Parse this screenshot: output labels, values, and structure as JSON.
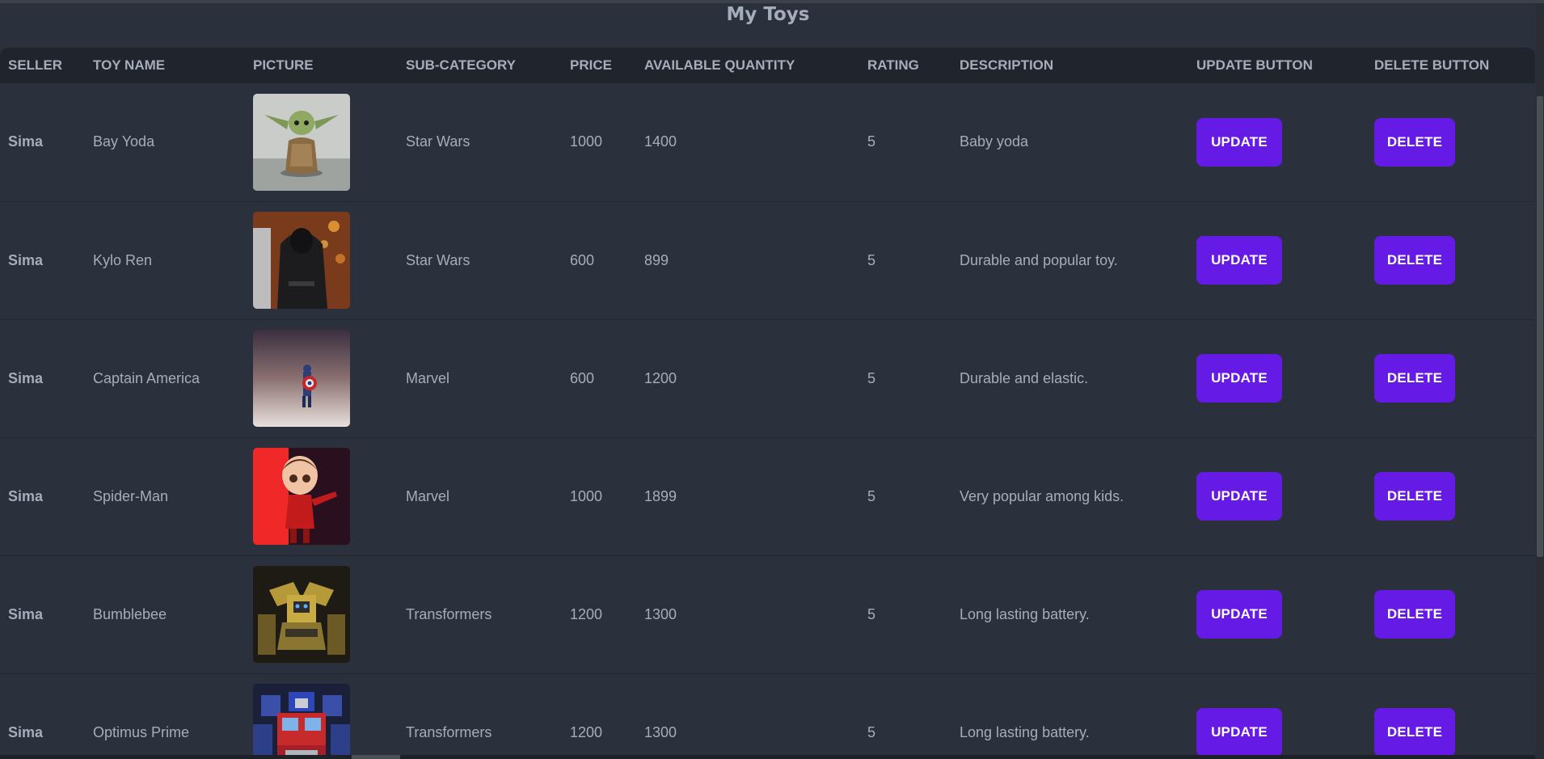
{
  "page": {
    "title": "My Toys"
  },
  "table": {
    "headers": [
      "SELLER",
      "TOY NAME",
      "PICTURE",
      "SUB-CATEGORY",
      "PRICE",
      "AVAILABLE QUANTITY",
      "RATING",
      "DESCRIPTION",
      "UPDATE BUTTON",
      "DELETE BUTTON"
    ],
    "update_label": "UPDATE",
    "delete_label": "DELETE",
    "rows": [
      {
        "seller": "Sima",
        "toy_name": "Bay Yoda",
        "picture": "baby-yoda-figure-photo",
        "sub_category": "Star Wars",
        "price": "1000",
        "quantity": "1400",
        "rating": "5",
        "description": "Baby yoda"
      },
      {
        "seller": "Sima",
        "toy_name": "Kylo Ren",
        "picture": "kylo-ren-figure-photo",
        "sub_category": "Star Wars",
        "price": "600",
        "quantity": "899",
        "rating": "5",
        "description": "Durable and popular toy."
      },
      {
        "seller": "Sima",
        "toy_name": "Captain America",
        "picture": "captain-america-figure-photo",
        "sub_category": "Marvel",
        "price": "600",
        "quantity": "1200",
        "rating": "5",
        "description": "Durable and elastic."
      },
      {
        "seller": "Sima",
        "toy_name": "Spider-Man",
        "picture": "spider-man-figure-photo",
        "sub_category": "Marvel",
        "price": "1000",
        "quantity": "1899",
        "rating": "5",
        "description": "Very popular among kids."
      },
      {
        "seller": "Sima",
        "toy_name": "Bumblebee",
        "picture": "bumblebee-figure-photo",
        "sub_category": "Transformers",
        "price": "1200",
        "quantity": "1300",
        "rating": "5",
        "description": "Long lasting battery."
      },
      {
        "seller": "Sima",
        "toy_name": "Optimus Prime",
        "picture": "optimus-prime-figure-photo",
        "sub_category": "Transformers",
        "price": "1200",
        "quantity": "1300",
        "rating": "5",
        "description": "Long lasting battery."
      }
    ]
  },
  "colors": {
    "background": "#2a303c",
    "header_row": "#1f242d",
    "text": "#a6adba",
    "button": "#661ae6",
    "button_text": "#ffffff"
  }
}
